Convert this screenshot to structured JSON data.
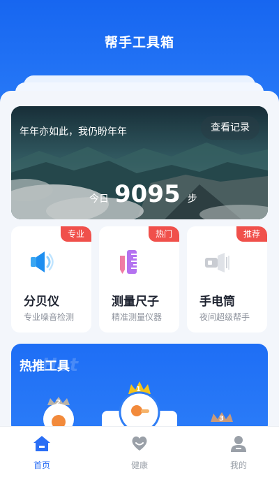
{
  "app": {
    "title": "帮手工具箱"
  },
  "hero": {
    "slogan": "年年亦如此，我仍盼年年",
    "record_button": "查看记录",
    "steps_label": "今日",
    "steps_value": "9095",
    "steps_unit": "步"
  },
  "tools": [
    {
      "name": "分贝仪",
      "desc": "专业噪音检测",
      "badge": "专业",
      "icon": "speaker-icon"
    },
    {
      "name": "测量尺子",
      "desc": "精准测量仪器",
      "badge": "热门",
      "icon": "ruler-icon"
    },
    {
      "name": "手电筒",
      "desc": "夜间超级帮手",
      "badge": "推荐",
      "icon": "flashlight-icon"
    }
  ],
  "hot": {
    "title": "热推工具",
    "watermark": "Hot",
    "ranks": [
      "1",
      "2",
      "3"
    ]
  },
  "nav": [
    {
      "label": "首页",
      "icon": "home-icon",
      "active": true
    },
    {
      "label": "健康",
      "icon": "heart-icon",
      "active": false
    },
    {
      "label": "我的",
      "icon": "profile-icon",
      "active": false
    }
  ],
  "colors": {
    "brand": "#1766f0",
    "badge": "#f0504b",
    "nav_active": "#2a6ef5",
    "nav_inactive": "#9aa0a8"
  }
}
